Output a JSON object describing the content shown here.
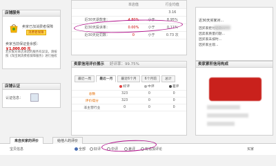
{
  "left": {
    "service_title": "店铺服务",
    "icon_text": "卖家已加消费者保障",
    "badge": "消费者保障",
    "deposit_label": "卖家当前保证金余额：",
    "deposit_amount": "￥1,000.00 元",
    "note": "若买家对本店承诺的服务有异议，请按照《淘宝网消费者保障服务》进行维权",
    "cert_title": "店铺认证",
    "cert_label": "认证信息："
  },
  "stats": {
    "header_blank": "",
    "header_store": "本店值",
    "header_compare": "",
    "header_industry": "行业均值",
    "rows": [
      {
        "label": "",
        "store": "",
        "compare": "",
        "industry": "3.16"
      },
      {
        "label": "近30天退款率：",
        "store": "4.80%",
        "compare": "小于",
        "industry": "8.95%"
      },
      {
        "label": "近30天投诉率：",
        "store": "0.00%",
        "compare": "小于",
        "industry": "0.11%"
      },
      {
        "label": "近30天处罚数：",
        "store": "0",
        "compare": "小于",
        "industry": "0.73 次"
      }
    ]
  },
  "right": {
    "title": "近30天买家对...",
    "lines": [
      "因买家拒付退款...",
      "因卖家质量问题...",
      "因买家未按时...",
      "因买家主观..."
    ]
  },
  "review": {
    "title": "卖家信用评价展示",
    "rate": "好评率：99.75%",
    "tabs": [
      "最近一周",
      "最近一月",
      "最近6个月",
      "6个月前",
      "总计"
    ],
    "headers": [
      "",
      "好评",
      "中评",
      "差评"
    ],
    "rows": [
      {
        "label": "总数",
        "good": "323",
        "mid": "0",
        "bad": "0"
      },
      {
        "label": "评价得分",
        "good": "323",
        "mid": "0",
        "bad": "0"
      },
      {
        "label": "非主营行业",
        "good": "0",
        "mid": "0",
        "bad": "0"
      }
    ]
  },
  "seller": {
    "title": "卖家累积信用构成"
  },
  "bottom": {
    "tabs": [
      "来自买家的评价",
      "给他人的评价"
    ],
    "filter": {
      "all_label": "宝贝信息",
      "options": [
        "全部",
        "好评",
        "中评",
        "差评",
        "有追加评论"
      ],
      "right_label": "买家"
    }
  }
}
